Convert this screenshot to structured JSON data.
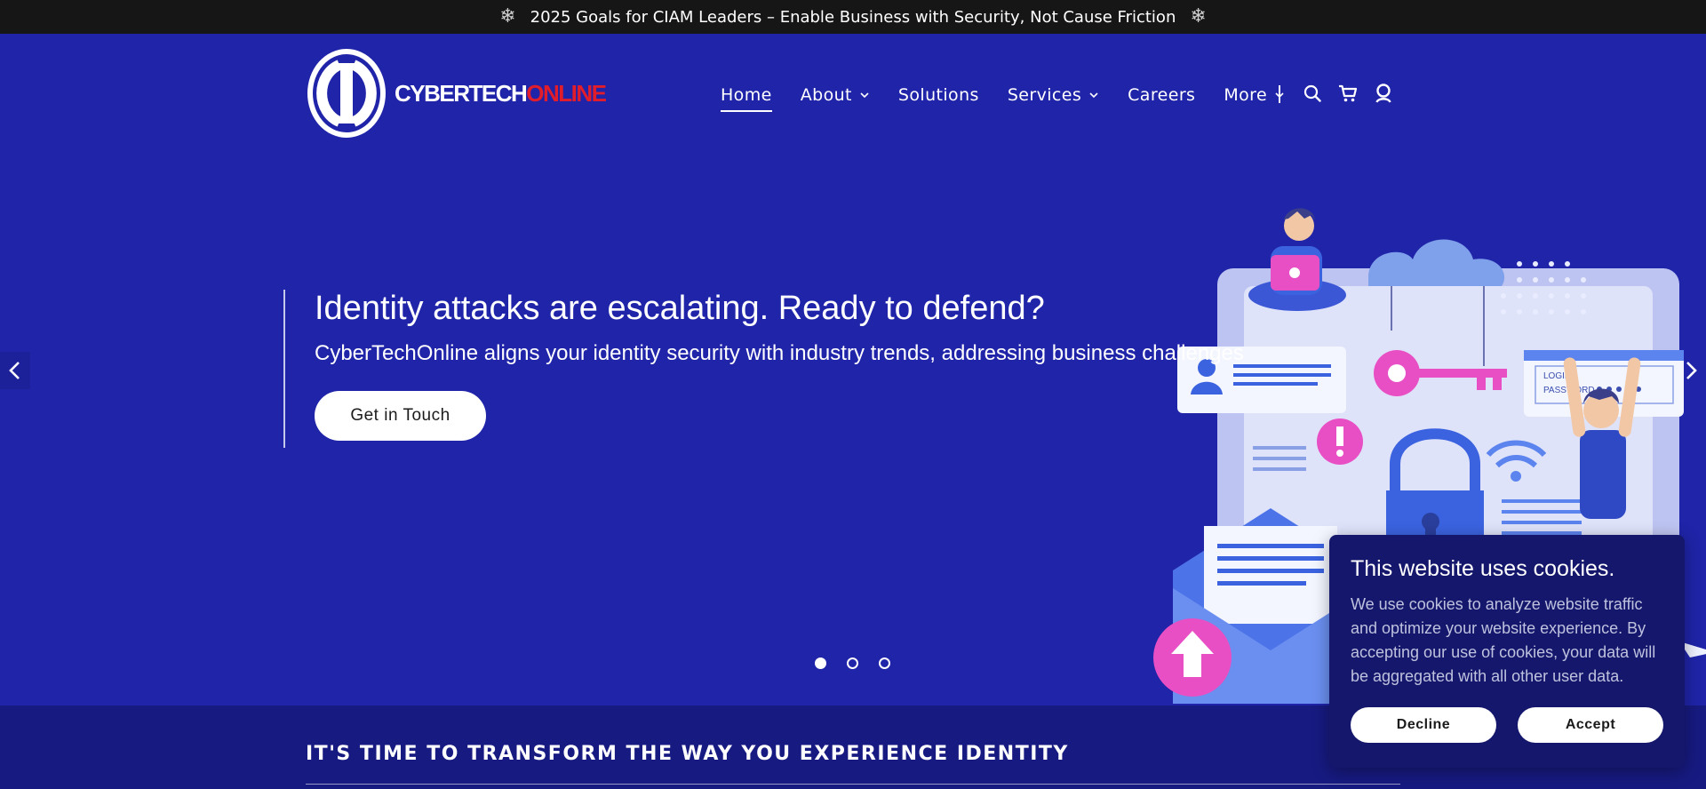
{
  "announcement": {
    "text": "2025 Goals for CIAM Leaders – Enable Business with Security, Not Cause Friction"
  },
  "logo": {
    "text_primary": "CYBERTECH",
    "text_accent": "ONLINE"
  },
  "nav": {
    "items": [
      {
        "label": "Home",
        "active": true,
        "has_dropdown": false
      },
      {
        "label": "About",
        "active": false,
        "has_dropdown": true
      },
      {
        "label": "Solutions",
        "active": false,
        "has_dropdown": false
      },
      {
        "label": "Services",
        "active": false,
        "has_dropdown": true
      },
      {
        "label": "Careers",
        "active": false,
        "has_dropdown": false
      },
      {
        "label": "More",
        "active": false,
        "has_dropdown": true
      }
    ],
    "icons": [
      "search-icon",
      "cart-icon",
      "account-icon"
    ]
  },
  "hero": {
    "title": "Identity attacks are escalating. Ready to defend?",
    "subtitle": "CyberTechOnline aligns your identity security with industry trends, addressing business challenges",
    "cta_label": "Get in Touch",
    "slide_count": 3,
    "active_slide": 1,
    "illustration": {
      "login_label": "LOGIN",
      "password_label": "PASSWORD"
    }
  },
  "section": {
    "title": "IT'S TIME TO TRANSFORM THE WAY YOU EXPERIENCE IDENTITY"
  },
  "cookie": {
    "title": "This website uses cookies.",
    "body": "We use cookies to analyze website traffic and optimize your website experience. By accepting our use of cookies, your data will be aggregated with all other user data.",
    "decline_label": "Decline",
    "accept_label": "Accept"
  },
  "colors": {
    "header_bg": "#1f24a8",
    "announcement_bg": "#161616",
    "section_bg": "#171a80",
    "cookie_bg": "#14176b",
    "logo_accent": "#e11d2b",
    "illustration_pink": "#e84fc4"
  }
}
